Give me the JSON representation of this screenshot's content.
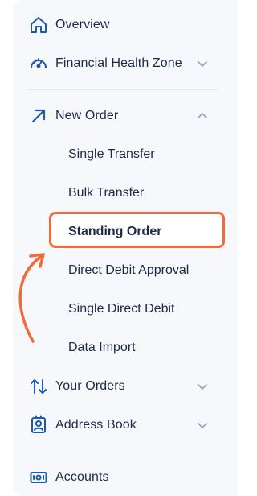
{
  "nav": {
    "overview": {
      "label": "Overview",
      "icon": "home-icon"
    },
    "financial_health": {
      "label": "Financial Health Zone",
      "icon": "gauge-icon",
      "expanded": false
    },
    "new_order": {
      "label": "New Order",
      "icon": "arrow-up-right-icon",
      "expanded": true,
      "items": [
        {
          "label": "Single Transfer"
        },
        {
          "label": "Bulk Transfer"
        },
        {
          "label": "Standing Order",
          "active": true
        },
        {
          "label": "Direct Debit Approval"
        },
        {
          "label": "Single Direct Debit"
        },
        {
          "label": "Data Import"
        }
      ]
    },
    "your_orders": {
      "label": "Your Orders",
      "icon": "arrows-up-down-icon",
      "expanded": false
    },
    "address_book": {
      "label": "Address Book",
      "icon": "contact-card-icon",
      "expanded": false
    },
    "accounts": {
      "label": "Accounts",
      "icon": "banknote-icon"
    }
  },
  "colors": {
    "icon": "#1e5aa8",
    "text": "#1f2a44",
    "chevron": "#9aa5b5",
    "highlight": "#ee6b3d",
    "panel": "#f6f8fb"
  }
}
